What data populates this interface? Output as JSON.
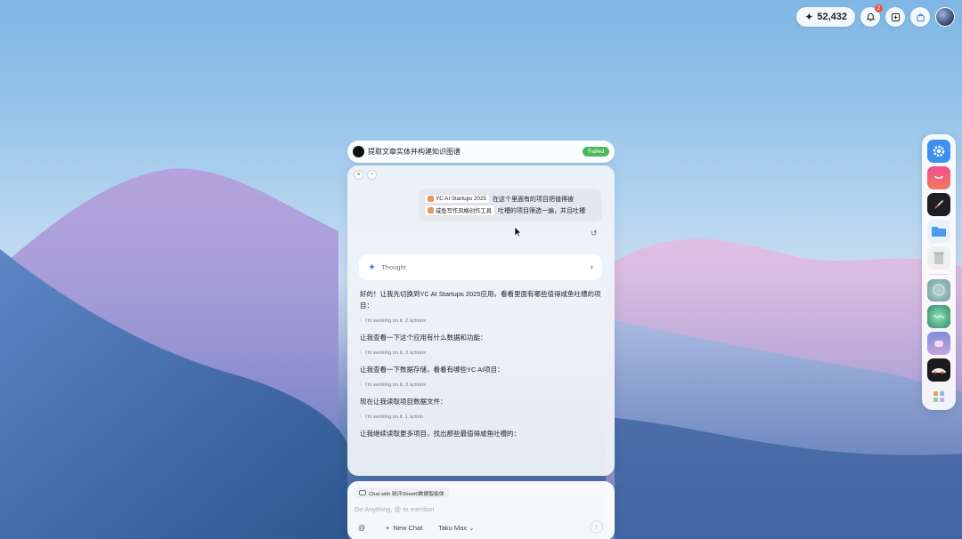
{
  "topbar": {
    "credits": "52,432",
    "notification_count": "2"
  },
  "task": {
    "title": "提取文章实体并构建知识图谱",
    "status": "Failed"
  },
  "panel": {
    "close": "×",
    "minimize": "−",
    "user_message": {
      "chip1": "YC AI Startups 2025",
      "line1_text": "在这个里面有的项目把值得被",
      "chip2": "咸鱼写作风格创作工具",
      "line2_text": "吐槽的项目筛选一遍，并且吐槽"
    },
    "thought_label": "Thought",
    "messages": [
      {
        "text": "好的！让我先切换到YC AI Startups 2025应用，看看里面有哪些值得咸鱼吐槽的项目：",
        "actions": "I'm working on it.  2 actions"
      },
      {
        "text": "让我查看一下这个应用有什么数据和功能：",
        "actions": "I'm working on it.  3 actions"
      },
      {
        "text": "让我查看一下数据存储，看看有哪些YC AI项目：",
        "actions": "I'm working on it.  3 actions"
      },
      {
        "text": "现在让我读取项目数据文件：",
        "actions": "I'm working on it.  1 action"
      },
      {
        "text": "让我继续读取更多项目，找出那些最值得咸鱼吐槽的：",
        "actions": ""
      }
    ]
  },
  "composer": {
    "context_chip": "Chat with 锐评Sheet0数据智能体",
    "placeholder": "Do Anything, @ to mention",
    "at": "@",
    "new_chat": "New Chat",
    "model": "Taku Max"
  },
  "colors": {
    "failed": "#4cb85c",
    "accent": "#4a7ef0",
    "badge": "#e8554a"
  }
}
